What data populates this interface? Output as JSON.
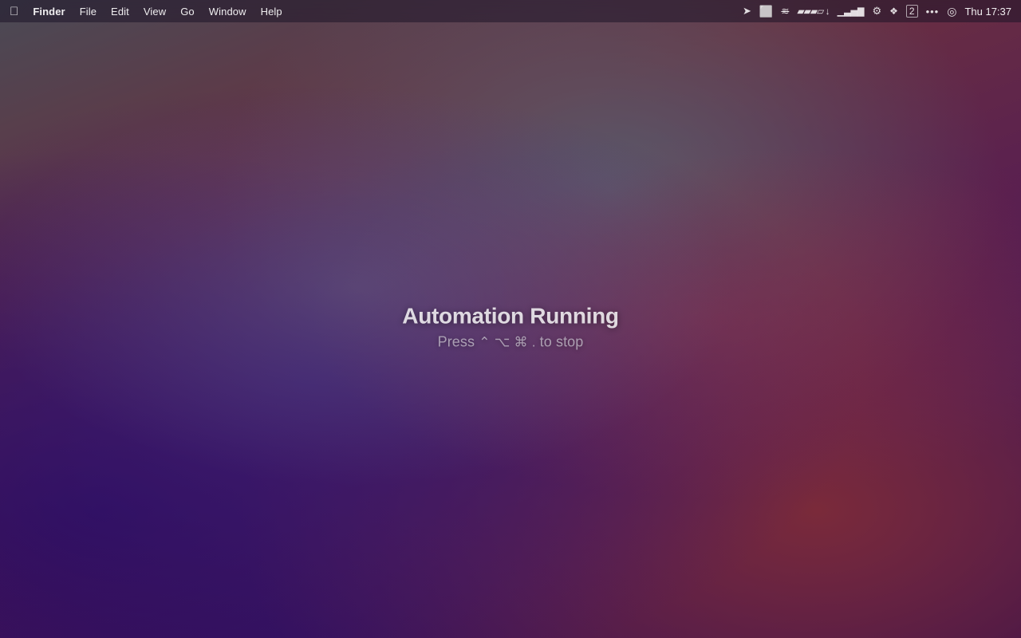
{
  "menubar": {
    "apple_label": "",
    "menus": [
      "Finder",
      "File",
      "Edit",
      "View",
      "Go",
      "Window",
      "Help"
    ],
    "datetime": "Thu 17:37"
  },
  "automation": {
    "title": "Automation Running",
    "subtitle_prefix": "Press",
    "key_symbols": "⌃ ⌥ ⌘.",
    "subtitle_suffix": "to stop"
  },
  "status_icons": {
    "location": "▲",
    "screen_record": "□",
    "mute": "≈",
    "battery": "▬",
    "signal": "|||",
    "wifi": "(((",
    "dropbox": "◆",
    "calendar": "2",
    "more": "···",
    "user": "◯"
  }
}
